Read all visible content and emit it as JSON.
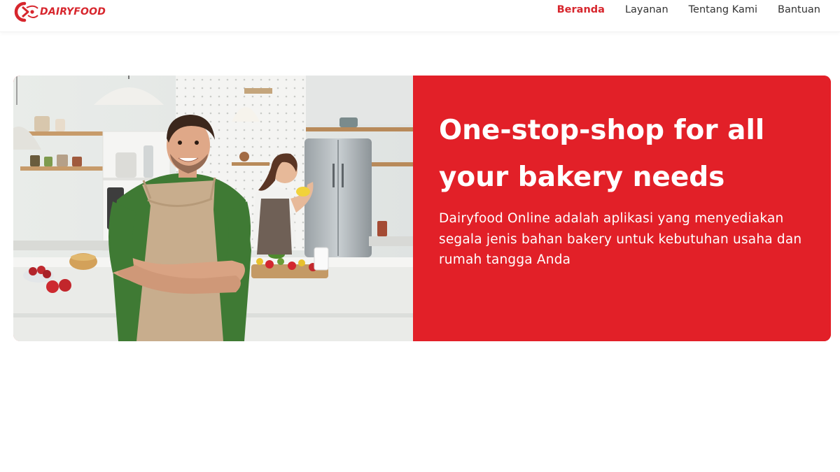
{
  "brand": {
    "name": "DAIRYFOOD",
    "color": "#d7262d"
  },
  "nav": {
    "items": [
      {
        "label": "Beranda",
        "active": true
      },
      {
        "label": "Layanan",
        "active": false
      },
      {
        "label": "Tentang Kami",
        "active": false
      },
      {
        "label": "Bantuan",
        "active": false
      }
    ]
  },
  "hero": {
    "title": "One-stop-shop for all your bakery needs",
    "description": "Dairyfood Online adalah aplikasi yang menyediakan segala jenis bahan bakery untuk kebutuhan usaha dan rumah tangga Anda",
    "panel_color": "#e22028",
    "image": "kitchen-chefs-photo"
  }
}
